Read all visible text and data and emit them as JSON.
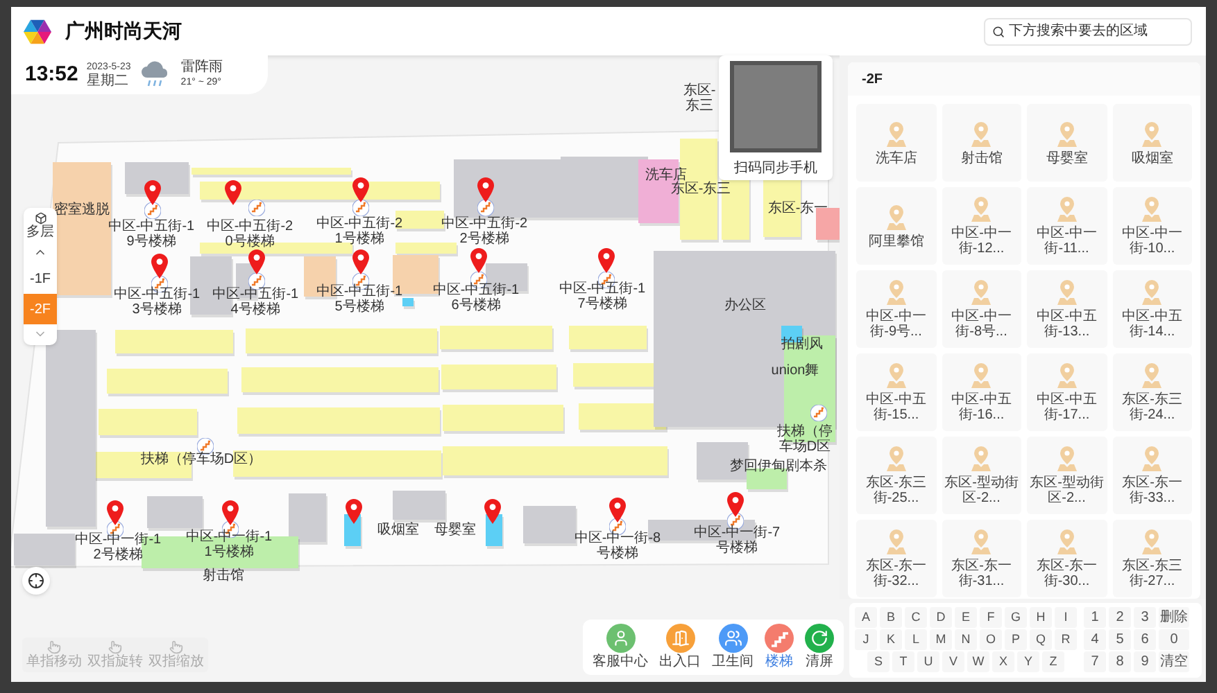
{
  "header": {
    "title": "广州时尚天河",
    "search": {
      "placeholder": "下方搜索中要去的区域"
    }
  },
  "status": {
    "time": "13:52",
    "date": "2023-5-23",
    "weekday": "星期二",
    "weather": "雷阵雨",
    "temperature": "21° ~ 29°"
  },
  "floor_switcher": {
    "label": "多层",
    "floors": [
      {
        "label": "-1F",
        "selected": false
      },
      {
        "label": "-2F",
        "selected": true
      }
    ]
  },
  "map": {
    "labels": [
      "东区-东三",
      "中区-中五街-19号楼梯",
      "中区-中五街-20号楼梯",
      "中区-中五街-21号楼梯",
      "中区-中五街-22号楼梯",
      "密室逃脱",
      "洗车店",
      "东区-东三",
      "东区-东一",
      "中区-中五街-13号楼梯",
      "中区-中五街-14号楼梯",
      "中区-中五街-15号楼梯",
      "中区-中五街-16号楼梯",
      "中区-中五街-17号楼梯",
      "办公区",
      "拍剧风",
      "union舞",
      "扶梯（停车场D区）",
      "扶梯（停车场D区",
      "梦回伊甸剧本杀",
      "中区-中一街-12号楼梯",
      "中区-中一街-11号楼梯",
      "吸烟室",
      "母婴室",
      "中区-中一街-8号楼梯",
      "中区-中一街-7号楼梯",
      "射击馆"
    ]
  },
  "qr_popup": {
    "caption": "扫码同步手机"
  },
  "gestures": [
    "单指移动",
    "双指旋转",
    "双指缩放"
  ],
  "categories": [
    {
      "label": "客服中心",
      "kind": "service",
      "color": "#6cc070",
      "selected": false
    },
    {
      "label": "出入口",
      "kind": "exit",
      "color": "#f7a03a",
      "selected": false
    },
    {
      "label": "卫生间",
      "kind": "restroom",
      "color": "#4d9af7",
      "selected": false
    },
    {
      "label": "楼梯",
      "kind": "stairs",
      "color": "#f47c6d",
      "selected": true
    },
    {
      "label": "清屏",
      "kind": "clear",
      "color": "#22b14c",
      "selected": false
    }
  ],
  "panel": {
    "floor": "-2F",
    "places": [
      "洗车店",
      "射击馆",
      "母婴室",
      "吸烟室",
      "阿里攀馆",
      "中区-中一街-12...",
      "中区-中一街-11...",
      "中区-中一街-10...",
      "中区-中一街-9号...",
      "中区-中一街-8号...",
      "中区-中五街-13...",
      "中区-中五街-14...",
      "中区-中五街-15...",
      "中区-中五街-16...",
      "中区-中五街-17...",
      "东区-东三街-24...",
      "东区-东三街-25...",
      "东区-型动街区-2...",
      "东区-型动街区-2...",
      "东区-东一街-33...",
      "东区-东一街-32...",
      "东区-东一街-31...",
      "东区-东一街-30...",
      "东区-东三街-27..."
    ]
  },
  "keyboard": {
    "letter_rows": [
      [
        "A",
        "B",
        "C",
        "D",
        "E",
        "F",
        "G",
        "H",
        "I"
      ],
      [
        "J",
        "K",
        "L",
        "M",
        "N",
        "O",
        "P",
        "Q",
        "R"
      ],
      [
        "S",
        "T",
        "U",
        "V",
        "W",
        "X",
        "Y",
        "Z"
      ]
    ],
    "number_rows": [
      [
        "1",
        "2",
        "3",
        "删除"
      ],
      [
        "4",
        "5",
        "6",
        "0"
      ],
      [
        "7",
        "8",
        "9",
        "清空"
      ]
    ]
  }
}
